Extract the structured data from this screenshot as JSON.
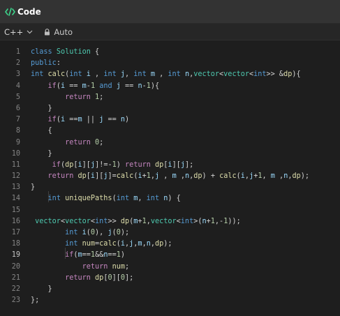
{
  "panel": {
    "title": "Code",
    "icon": "code-brackets-icon",
    "accent": "#3dd68c"
  },
  "toolbar": {
    "language": "C++",
    "mode": "Auto"
  },
  "editor": {
    "active_line": 19,
    "lines": [
      {
        "n": "1",
        "text": "class Solution {"
      },
      {
        "n": "2",
        "text": "public:"
      },
      {
        "n": "3",
        "text": "int calc(int i , int j, int m , int n,vector<vector<int>> &dp){"
      },
      {
        "n": "4",
        "text": "    if(i == m-1 and j == n-1){"
      },
      {
        "n": "5",
        "text": "        return 1;"
      },
      {
        "n": "6",
        "text": "    }"
      },
      {
        "n": "7",
        "text": "    if(i ==m || j == n)"
      },
      {
        "n": "8",
        "text": "    {"
      },
      {
        "n": "9",
        "text": "        return 0;"
      },
      {
        "n": "10",
        "text": "    }"
      },
      {
        "n": "11",
        "text": "     if(dp[i][j]!=-1) return dp[i][j];"
      },
      {
        "n": "12",
        "text": "    return dp[i][j]=calc(i+1,j , m ,n,dp) + calc(i,j+1, m ,n,dp);"
      },
      {
        "n": "13",
        "text": "}"
      },
      {
        "n": "14",
        "text": "    int uniquePaths(int m, int n) {"
      },
      {
        "n": "15",
        "text": ""
      },
      {
        "n": "16",
        "text": " vector<vector<int>> dp(m+1,vector<int>(n+1,-1));"
      },
      {
        "n": "17",
        "text": "        int i(0), j(0);"
      },
      {
        "n": "18",
        "text": "        int num=calc(i,j,m,n,dp);"
      },
      {
        "n": "19",
        "text": "        if(m==1&&n==1)"
      },
      {
        "n": "20",
        "text": "            return num;"
      },
      {
        "n": "21",
        "text": "        return dp[0][0];"
      },
      {
        "n": "22",
        "text": "    }"
      },
      {
        "n": "23",
        "text": "};"
      }
    ]
  }
}
